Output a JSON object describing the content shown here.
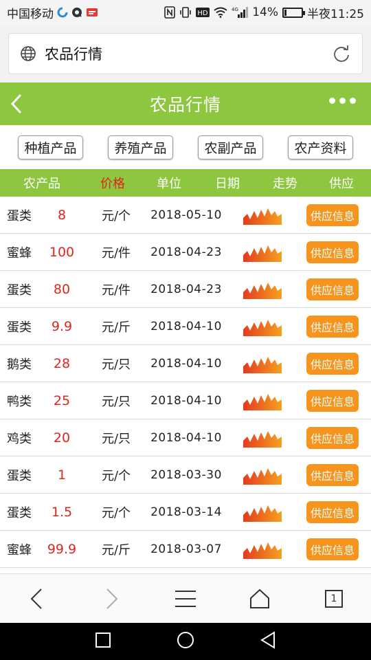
{
  "status": {
    "carrier": "中国移动",
    "battery": "14%",
    "battery_level": 0.14,
    "time_label": "半夜11:25",
    "network": "4G",
    "hd_label": "HD"
  },
  "browser": {
    "url_title": "农品行情",
    "tab_count": "1"
  },
  "header": {
    "title": "农品行情"
  },
  "categories": [
    {
      "label": "种植产品"
    },
    {
      "label": "养殖产品"
    },
    {
      "label": "农副产品"
    },
    {
      "label": "农产资料"
    }
  ],
  "table": {
    "columns": [
      "农产品",
      "价格",
      "单位",
      "日期",
      "走势",
      "供应"
    ],
    "supply_label": "供应信息",
    "rows": [
      {
        "name": "蛋类",
        "price": "8",
        "unit": "元/个",
        "date": "2018-05-10"
      },
      {
        "name": "蜜蜂",
        "price": "100",
        "unit": "元/件",
        "date": "2018-04-23"
      },
      {
        "name": "蛋类",
        "price": "80",
        "unit": "元/件",
        "date": "2018-04-23"
      },
      {
        "name": "蛋类",
        "price": "9.9",
        "unit": "元/斤",
        "date": "2018-04-10"
      },
      {
        "name": "鹅类",
        "price": "28",
        "unit": "元/只",
        "date": "2018-04-10"
      },
      {
        "name": "鸭类",
        "price": "25",
        "unit": "元/只",
        "date": "2018-04-10"
      },
      {
        "name": "鸡类",
        "price": "20",
        "unit": "元/只",
        "date": "2018-04-10"
      },
      {
        "name": "蛋类",
        "price": "1",
        "unit": "元/个",
        "date": "2018-03-30"
      },
      {
        "name": "蛋类",
        "price": "1.5",
        "unit": "元/个",
        "date": "2018-03-14"
      },
      {
        "name": "蜜蜂",
        "price": "99.9",
        "unit": "元/斤",
        "date": "2018-03-07"
      }
    ]
  },
  "colors": {
    "brand_green": "#8dc63f",
    "price_red": "#e0261c",
    "supply_orange": "#f7941d"
  }
}
